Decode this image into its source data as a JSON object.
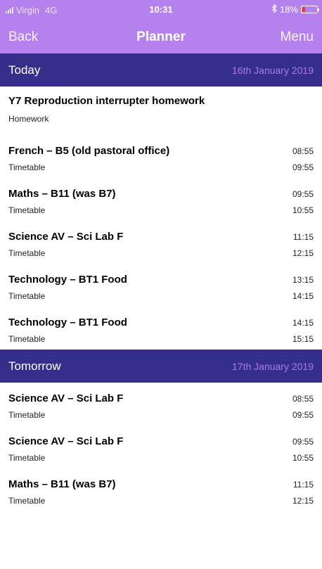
{
  "status_bar": {
    "carrier": "Virgin",
    "network": "4G",
    "time": "10:31",
    "battery": "18%",
    "battery_level": 0.18,
    "battery_color": "#ff2d2d"
  },
  "nav": {
    "back": "Back",
    "title": "Planner",
    "menu": "Menu"
  },
  "colors": {
    "header_bg": "#b581ee",
    "section_bg": "#352e8a",
    "section_date": "#a77ce9"
  },
  "sections": [
    {
      "day": "Today",
      "date": "16th January 2019",
      "items": [
        {
          "subject": "Y7 Reproduction interrupter homework",
          "type": "Homework",
          "start": "",
          "end": ""
        },
        {
          "subject": "French – B5 (old pastoral office)",
          "type": "Timetable",
          "start": "08:55",
          "end": "09:55"
        },
        {
          "subject": "Maths – B11 (was B7)",
          "type": "Timetable",
          "start": "09:55",
          "end": "10:55"
        },
        {
          "subject": "Science AV – Sci Lab F",
          "type": "Timetable",
          "start": "11:15",
          "end": "12:15"
        },
        {
          "subject": "Technology – BT1 Food",
          "type": "Timetable",
          "start": "13:15",
          "end": "14:15"
        },
        {
          "subject": "Technology – BT1 Food",
          "type": "Timetable",
          "start": "14:15",
          "end": "15:15"
        }
      ]
    },
    {
      "day": "Tomorrow",
      "date": "17th January 2019",
      "items": [
        {
          "subject": "Science AV – Sci Lab F",
          "type": "Timetable",
          "start": "08:55",
          "end": "09:55"
        },
        {
          "subject": "Science AV – Sci Lab F",
          "type": "Timetable",
          "start": "09:55",
          "end": "10:55"
        },
        {
          "subject": "Maths – B11 (was B7)",
          "type": "Timetable",
          "start": "11:15",
          "end": "12:15"
        }
      ]
    }
  ]
}
